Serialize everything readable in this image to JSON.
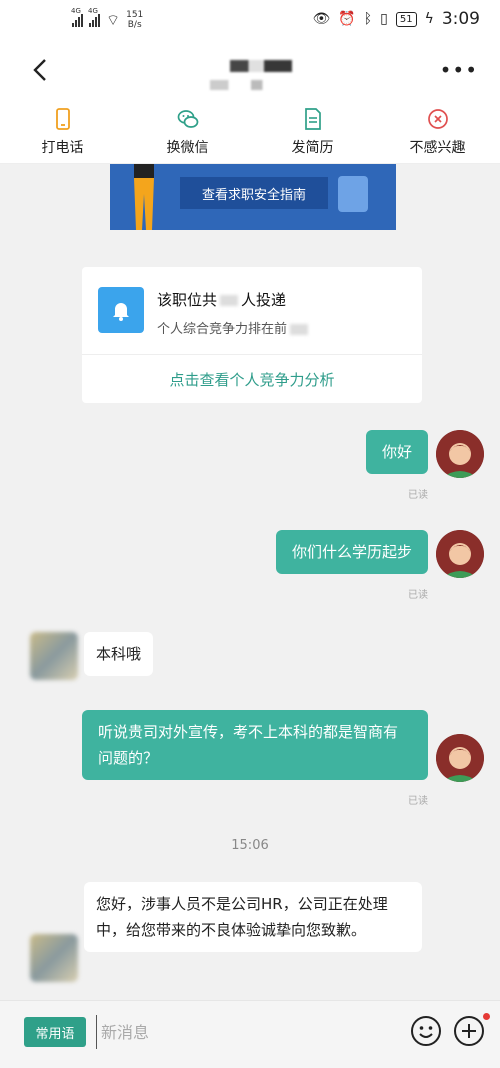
{
  "status_bar": {
    "network1": "4G",
    "network2": "4G",
    "speed_value": "151",
    "speed_unit": "B/s",
    "battery": "51",
    "time": "3:09"
  },
  "header": {
    "more_icon": "more-dots-icon",
    "back_icon": "chevron-left-icon"
  },
  "actions": [
    {
      "label": "打电话",
      "icon": "phone-icon",
      "color": "#f0a020"
    },
    {
      "label": "换微信",
      "icon": "wechat-icon",
      "color": "#2fa089"
    },
    {
      "label": "发简历",
      "icon": "resume-icon",
      "color": "#2fa089"
    },
    {
      "label": "不感兴趣",
      "icon": "close-circle-icon",
      "color": "#e05050"
    }
  ],
  "banner": {
    "button_label": "查看求职安全指南"
  },
  "competition_card": {
    "title_prefix": "该职位共",
    "title_suffix": "人投递",
    "subtitle": "个人综合竞争力排在前",
    "link": "点击查看个人竞争力分析"
  },
  "messages": [
    {
      "side": "right",
      "text": "你好",
      "status": "已读"
    },
    {
      "side": "right",
      "text": "你们什么学历起步",
      "status": "已读"
    },
    {
      "side": "left",
      "text": "本科哦"
    },
    {
      "side": "right",
      "text": "听说贵司对外宣传，考不上本科的都是智商有问题的？",
      "status": "已读"
    },
    {
      "side": "left",
      "text": "您好，涉事人员不是公司HR，公司正在处理中，给您带来的不良体验诚挚向您致歉。"
    }
  ],
  "timestamp": "15:06",
  "input_bar": {
    "quick_phrases": "常用语",
    "placeholder": "新消息"
  },
  "colors": {
    "accent": "#3fb39f",
    "link": "#2f9d8b",
    "banner": "#2f67b8"
  }
}
